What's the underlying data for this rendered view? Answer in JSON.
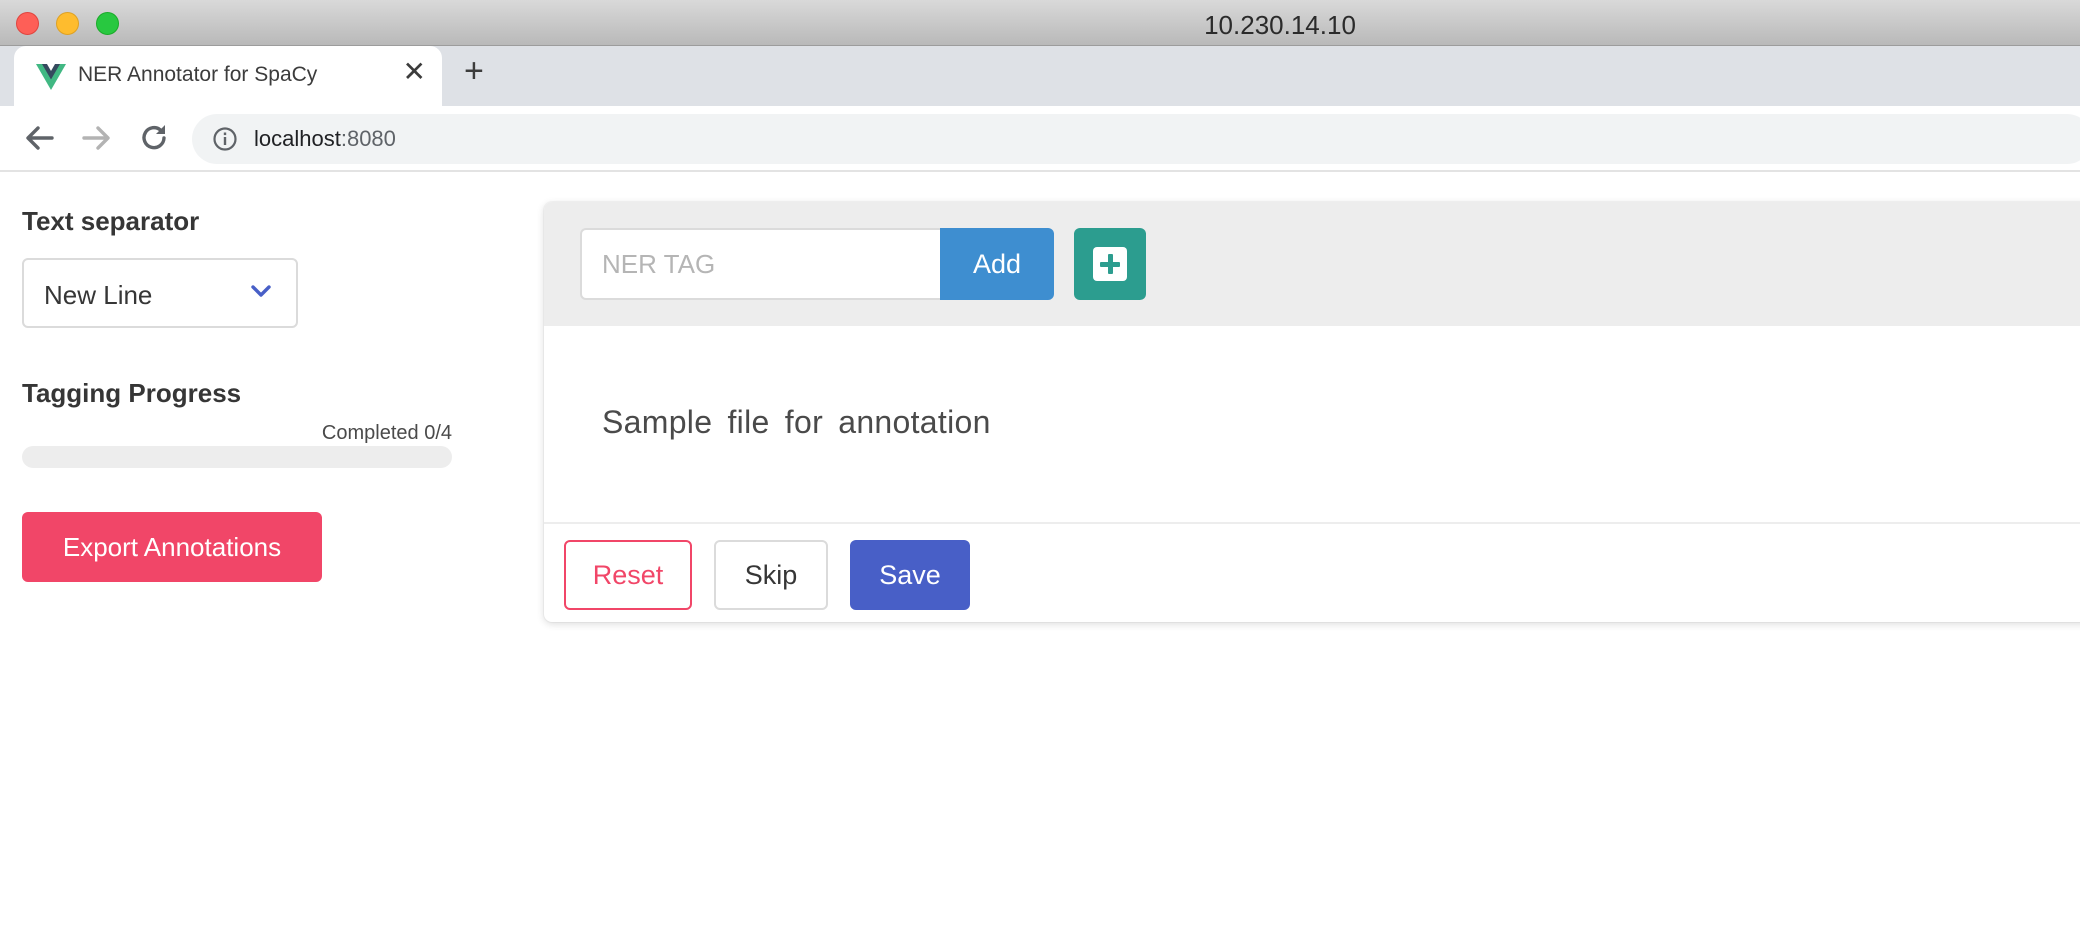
{
  "window": {
    "title": "10.230.14.10"
  },
  "browser": {
    "tab_title": "NER Annotator for SpaCy",
    "tab_close": "✕",
    "new_tab": "+",
    "url_host": "localhost",
    "url_port": ":8080"
  },
  "sidebar": {
    "separator_label": "Text separator",
    "separator_value": "New Line",
    "progress_label": "Tagging Progress",
    "progress_text": "Completed 0/4",
    "progress_fraction": 0,
    "export_label": "Export Annotations"
  },
  "tagbar": {
    "input_placeholder": "NER TAG",
    "input_value": "",
    "add_label": "Add"
  },
  "content": {
    "sample_text": "Sample file for annotation"
  },
  "footer": {
    "reset_label": "Reset",
    "skip_label": "Skip",
    "save_label": "Save"
  },
  "colors": {
    "danger": "#f14668",
    "info": "#3e8ed0",
    "teal": "#2c9d8f",
    "primary": "#485fc7",
    "vue_green": "#41b883",
    "vue_dark": "#35495e"
  },
  "icons": {
    "favicon": "vue-logo-icon",
    "back": "arrow-left-icon",
    "forward": "arrow-right-icon",
    "reload": "reload-icon",
    "site_info": "info-icon",
    "dropdown": "chevron-down-icon",
    "add_tag": "plus-square-icon"
  }
}
